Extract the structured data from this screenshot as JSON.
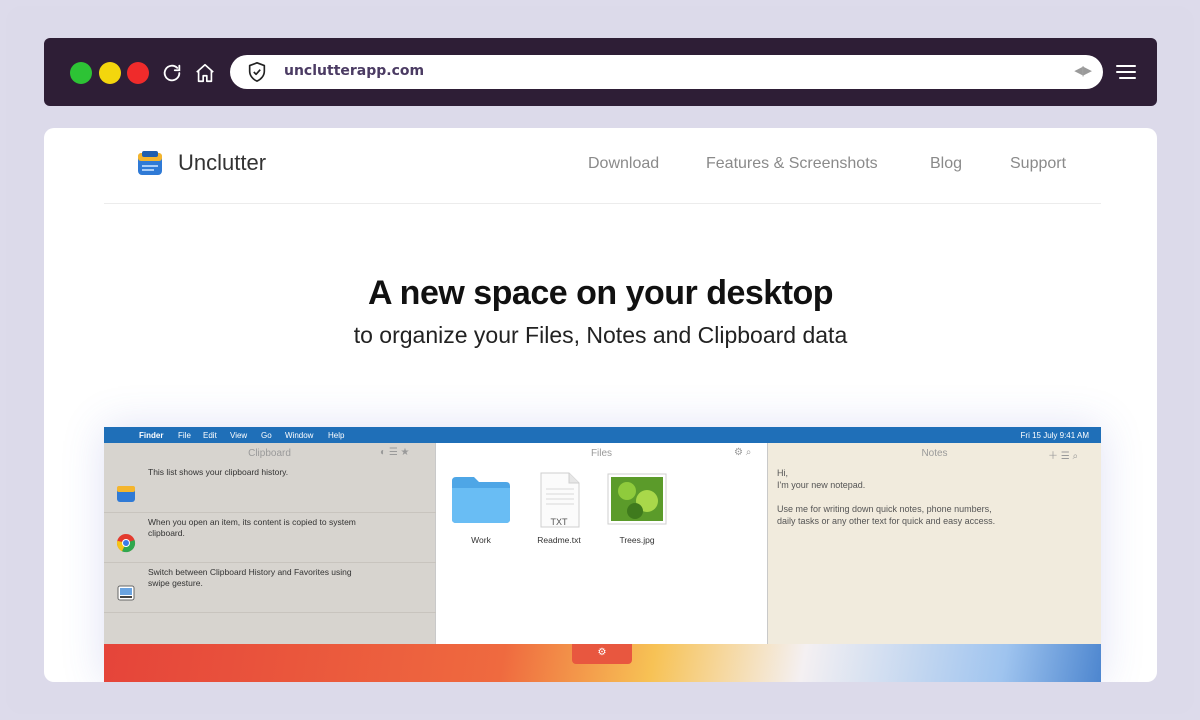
{
  "browser": {
    "url": "unclutterapp.com",
    "colors": {
      "frame": "#2e1e36",
      "close": "#ef2b2b",
      "minimize": "#f3d60d",
      "maximize": "#2dc335"
    }
  },
  "site": {
    "logo_text": "Unclutter",
    "nav": {
      "download": "Download",
      "features": "Features & Screenshots",
      "blog": "Blog",
      "support": "Support"
    },
    "hero": {
      "title": "A new space on your desktop",
      "subtitle": "to organize your Files, Notes and Clipboard data"
    }
  },
  "app_screenshot": {
    "menubar": {
      "items": [
        "Finder",
        "File",
        "Edit",
        "View",
        "Go",
        "Window",
        "Help"
      ],
      "clock": "Fri 15 July  9:41 AM"
    },
    "clipboard": {
      "title": "Clipboard",
      "items": [
        {
          "text": "This list shows your clipboard history.",
          "icon": "unclutter-app-icon"
        },
        {
          "text": "When you open an item, its content is copied to system clipboard.",
          "icon": "chrome-icon"
        },
        {
          "text": "Switch between Clipboard History and Favorites using swipe gesture.",
          "icon": "preview-icon"
        }
      ]
    },
    "files": {
      "title": "Files",
      "items": [
        {
          "label": "Work",
          "icon": "folder-icon"
        },
        {
          "label": "Readme.txt",
          "icon": "text-file-icon",
          "badge": "TXT"
        },
        {
          "label": "Trees.jpg",
          "icon": "image-file-icon"
        }
      ]
    },
    "notes": {
      "title": "Notes",
      "text_lines": [
        "Hi,",
        "I'm your new notepad.",
        "",
        "Use me for writing down quick notes, phone numbers,",
        "daily tasks or any other text for quick and easy access."
      ]
    }
  }
}
